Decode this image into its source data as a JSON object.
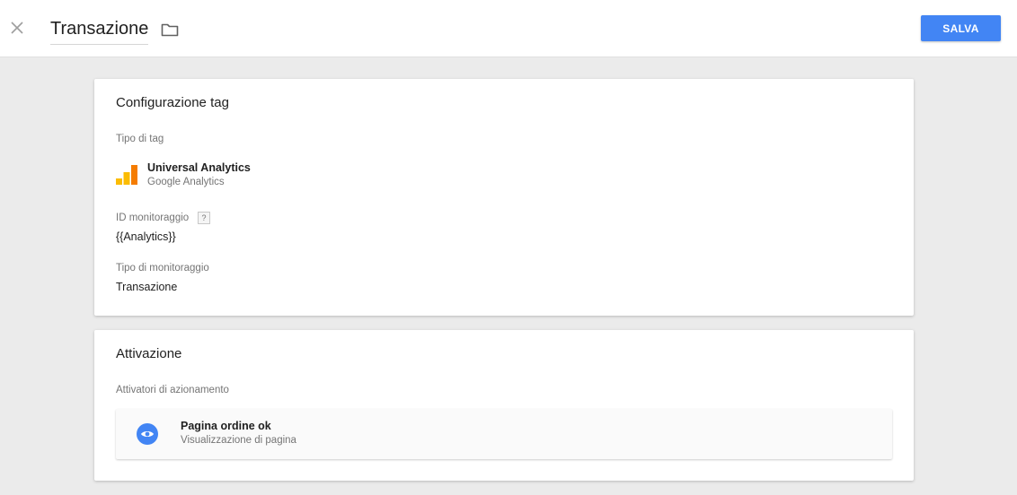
{
  "header": {
    "title": "Transazione",
    "save_label": "SALVA",
    "close_icon": "close-icon",
    "folder_icon": "folder-icon",
    "accent_color": "#4285f4"
  },
  "tag_config": {
    "title": "Configurazione tag",
    "tag_type_label": "Tipo di tag",
    "tag_type_name": "Universal Analytics",
    "tag_type_vendor": "Google Analytics",
    "tag_type_icon": "google-analytics-icon",
    "tracking_id_label": "ID monitoraggio",
    "tracking_id_help": "?",
    "tracking_id_value": "{{Analytics}}",
    "tracking_type_label": "Tipo di monitoraggio",
    "tracking_type_value": "Transazione"
  },
  "triggering": {
    "title": "Attivazione",
    "firing_triggers_label": "Attivatori di azionamento",
    "triggers": [
      {
        "name": "Pagina ordine ok",
        "type": "Visualizzazione di pagina",
        "icon": "eye-icon",
        "icon_color": "#4285f4"
      }
    ]
  }
}
